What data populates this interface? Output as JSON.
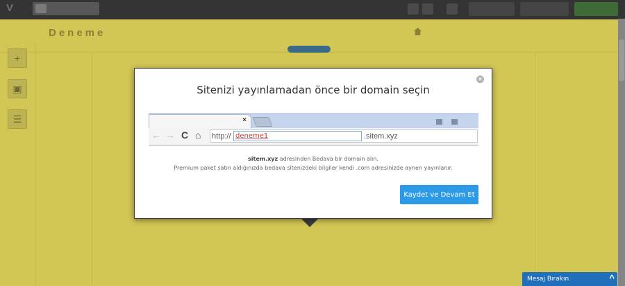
{
  "background": {
    "brand": "Deneme",
    "nav_items": [
      "",
      "",
      "",
      ""
    ]
  },
  "modal": {
    "title": "Sitenizi yayınlamadan önce bir domain seçin",
    "close_glyph": "×",
    "browser": {
      "tab_close_glyph": "×",
      "back_glyph": "←",
      "forward_glyph": "→",
      "reload_glyph": "C",
      "home_glyph": "⌂",
      "url_prefix": "http://",
      "domain_value": "deneme1",
      "url_suffix": ".sitem.xyz"
    },
    "info_domain": "sitem.xyz",
    "info_line1_rest": " adresinden Bedava bir domain alın.",
    "info_line2": "Premium paket satın aldığınızda bedava sitenizdeki bilgiler kendi .com adresinizde aynen yayınlanır.",
    "save_button": "Kaydet ve Devam Et"
  },
  "chat": {
    "label": "Mesaj Bırakın",
    "chevron": "^"
  },
  "colors": {
    "overlay_background": "#d2c655",
    "button_blue": "#2d9ae8",
    "chat_blue": "#1f6fba"
  }
}
